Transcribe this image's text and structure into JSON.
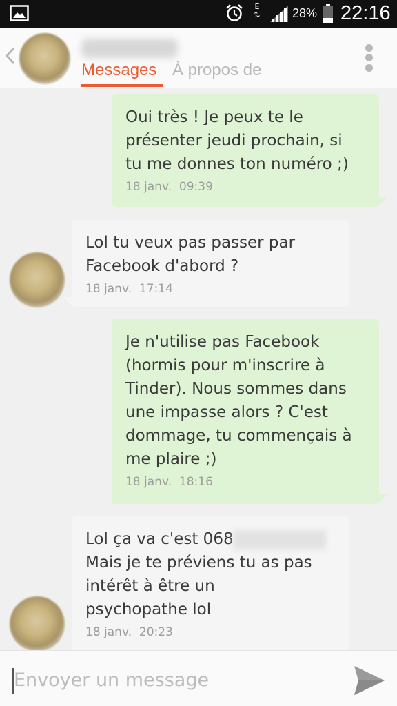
{
  "status_bar": {
    "network_type": "E",
    "battery": "28%",
    "time": "22:16",
    "icons": [
      "gallery-icon",
      "alarm-icon",
      "signal-icon",
      "battery-icon"
    ]
  },
  "header": {
    "tabs": [
      {
        "label": "Messages",
        "active": true
      },
      {
        "label": "À propos de",
        "active": false
      }
    ],
    "accent_color": "#ee5a32"
  },
  "messages": [
    {
      "from": "me",
      "text": "Oui très ! Je peux te le\nprésenter jeudi prochain, si\ntu me donnes ton numéro ;)",
      "date": "18 janv.",
      "time": "09:39"
    },
    {
      "from": "them",
      "text": "Lol tu veux pas passer par\nFacebook d'abord ?",
      "date": "18 janv.",
      "time": "17:14"
    },
    {
      "from": "me",
      "text": "Je n'utilise pas Facebook\n(hormis pour m'inscrire à\nTinder). Nous sommes dans\nune impasse alors ? C'est\ndommage, tu commençais à\nme plaire ;)",
      "date": "18 janv.",
      "time": "18:16"
    },
    {
      "from": "them",
      "text_line1": "Lol ça va c'est 068",
      "text": "Mais je te préviens tu as pas\nintérêt à être un\npsychopathe lol",
      "date": "18 janv.",
      "time": "20:23"
    }
  ],
  "composer": {
    "placeholder": "Envoyer un message"
  },
  "colors": {
    "sent_bubble": "#dff3d5",
    "received_bubble": "#f5f5f5"
  }
}
